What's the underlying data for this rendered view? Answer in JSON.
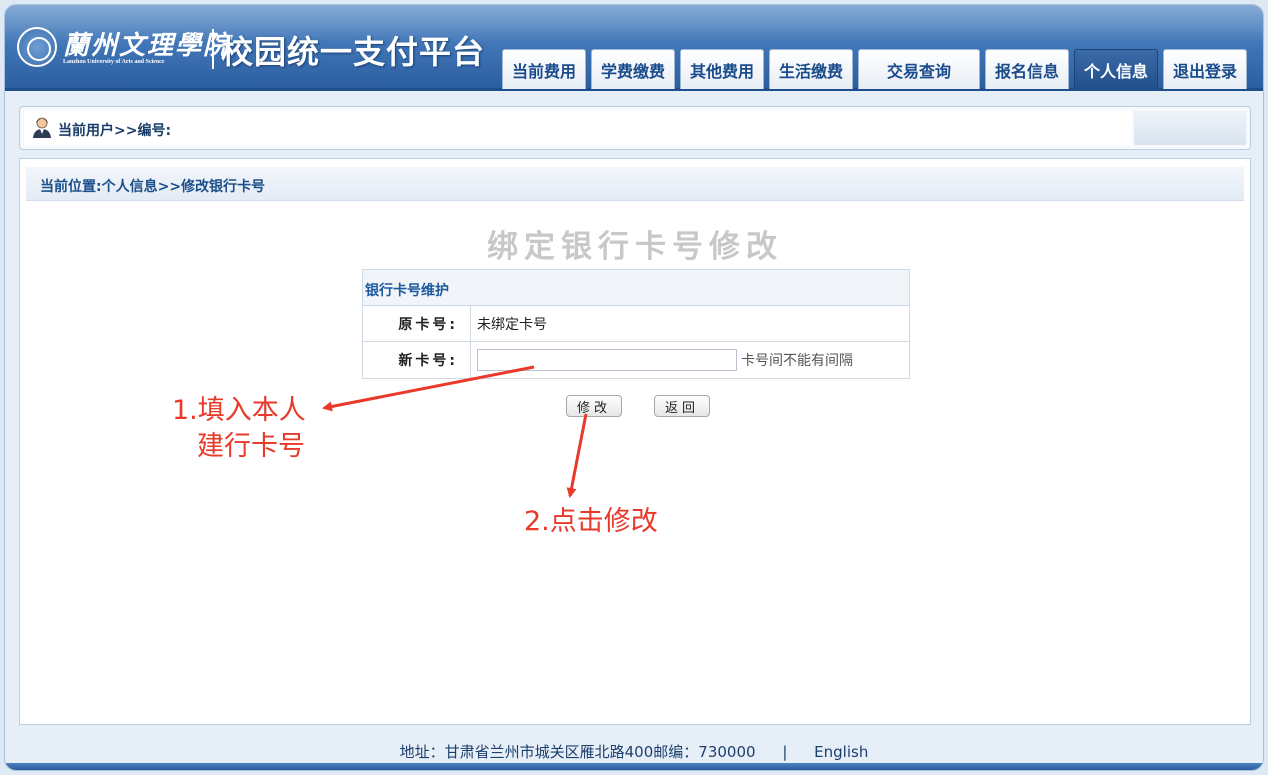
{
  "header": {
    "logo_cn": "蘭州文理學院",
    "logo_en": "Lanzhou University of Arts and Science",
    "site_title": "校园统一支付平台"
  },
  "nav": [
    {
      "label": "当前费用",
      "active": false
    },
    {
      "label": "学费缴费",
      "active": false
    },
    {
      "label": "其他费用",
      "active": false
    },
    {
      "label": "生活缴费",
      "active": false
    },
    {
      "label": "交易查询",
      "active": false
    },
    {
      "label": "报名信息",
      "active": false
    },
    {
      "label": "个人信息",
      "active": true
    },
    {
      "label": "退出登录",
      "active": false
    }
  ],
  "userbar": {
    "label": "当前用户>>编号:"
  },
  "breadcrumb": "当前位置:个人信息>>修改银行卡号",
  "page_heading": "绑定银行卡号修改",
  "form": {
    "section_title": "银行卡号维护",
    "old_card_label": "原卡号:",
    "old_card_value": "未绑定卡号",
    "new_card_label": "新卡号:",
    "new_card_value": "",
    "new_card_hint": "卡号间不能有间隔"
  },
  "buttons": {
    "modify": "修改",
    "back": "返回"
  },
  "annotations": {
    "step1_line1": "1.填入本人",
    "step1_line2": "建行卡号",
    "step2": "2.点击修改",
    "color": "#e8392a"
  },
  "footer": {
    "address": "地址：甘肃省兰州市城关区雁北路400邮编：730000",
    "separator": "|",
    "language_link": "English"
  }
}
